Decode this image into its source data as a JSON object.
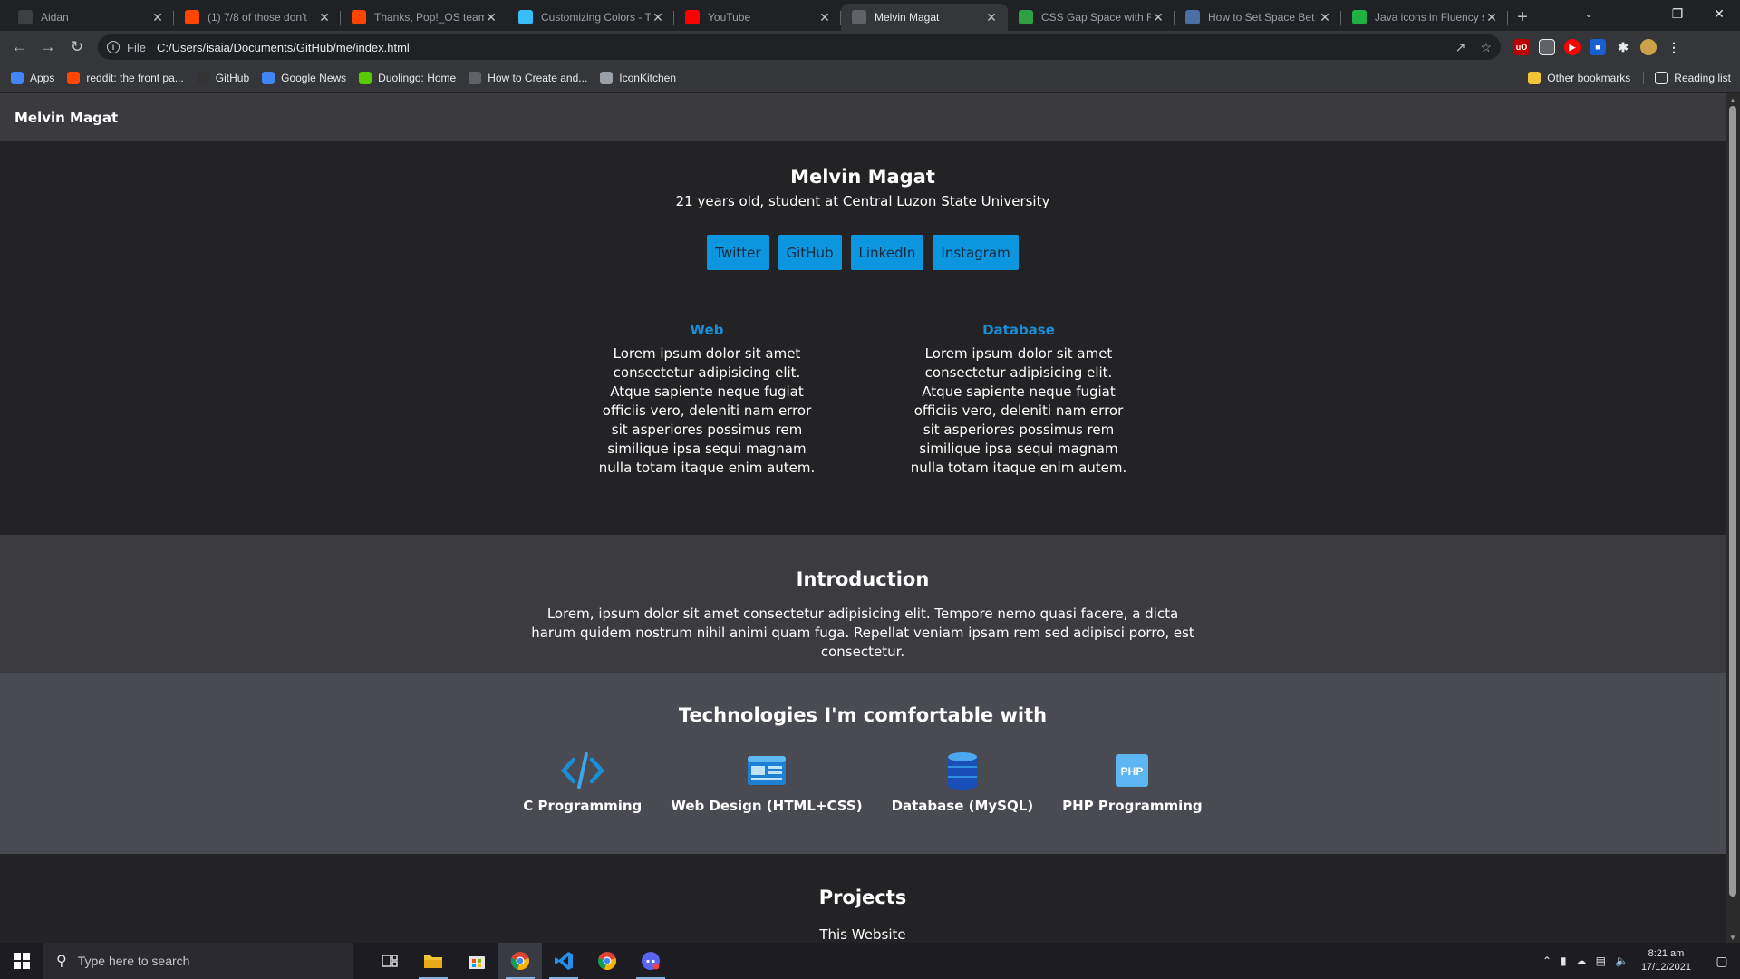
{
  "browser": {
    "tabs": [
      {
        "title": "Aidan",
        "icon": "aidan-favicon",
        "color": "#3c4043"
      },
      {
        "title": "(1) 7/8 of those don't",
        "icon": "reddit-favicon",
        "color": "#ff4500"
      },
      {
        "title": "Thanks, Pop!_OS team",
        "icon": "reddit-favicon",
        "color": "#ff4500"
      },
      {
        "title": "Customizing Colors - T",
        "icon": "tailwind-favicon",
        "color": "#38bdf8"
      },
      {
        "title": "YouTube",
        "icon": "youtube-favicon",
        "color": "#ff0000"
      },
      {
        "title": "Melvin Magat",
        "icon": "globe-favicon",
        "color": "#5f6368",
        "active": true
      },
      {
        "title": "CSS Gap Space with F",
        "icon": "css-favicon",
        "color": "#2ea043"
      },
      {
        "title": "How to Set Space Bet",
        "icon": "page-favicon",
        "color": "#4a6fa5"
      },
      {
        "title": "Java icons in Fluency s",
        "icon": "icons8-favicon",
        "color": "#1fb141"
      }
    ],
    "address": {
      "scheme": "File",
      "url": "C:/Users/isaia/Documents/GitHub/me/index.html"
    },
    "bookmarks": [
      {
        "label": "Apps",
        "icon": "apps-grid-icon",
        "color": "#4285f4"
      },
      {
        "label": "reddit: the front pa...",
        "icon": "reddit-icon",
        "color": "#ff4500"
      },
      {
        "label": "GitHub",
        "icon": "github-icon",
        "color": "#333333"
      },
      {
        "label": "Google News",
        "icon": "google-news-icon",
        "color": "#4285f4"
      },
      {
        "label": "Duolingo: Home",
        "icon": "duolingo-icon",
        "color": "#58cc02"
      },
      {
        "label": "How to Create and...",
        "icon": "page-icon",
        "color": "#5f6368"
      },
      {
        "label": "IconKitchen",
        "icon": "iconkitchen-icon",
        "color": "#9aa0a6"
      }
    ],
    "bookmarks_right": {
      "other": "Other bookmarks",
      "reading": "Reading list"
    }
  },
  "site": {
    "nav_title": "Melvin Magat",
    "hero": {
      "name": "Melvin Magat",
      "subtitle": "21 years old, student at Central Luzon State University",
      "socials": [
        "Twitter",
        "GitHub",
        "LinkedIn",
        "Instagram"
      ],
      "columns": [
        {
          "title": "Web",
          "text": "Lorem ipsum dolor sit amet consectetur adipisicing elit. Atque sapiente neque fugiat officiis vero, deleniti nam error sit asperiores possimus rem similique ipsa sequi magnam nulla totam itaque enim autem."
        },
        {
          "title": "Database",
          "text": "Lorem ipsum dolor sit amet consectetur adipisicing elit. Atque sapiente neque fugiat officiis vero, deleniti nam error sit asperiores possimus rem similique ipsa sequi magnam nulla totam itaque enim autem."
        }
      ]
    },
    "intro": {
      "title": "Introduction",
      "text": "Lorem, ipsum dolor sit amet consectetur adipisicing elit. Tempore nemo quasi facere, a dicta harum quidem nostrum nihil animi quam fuga. Repellat veniam ipsam rem sed adipisci porro, est consectetur."
    },
    "tech": {
      "title": "Technologies I'm comfortable with",
      "items": [
        {
          "label": "C Programming",
          "icon": "code-icon"
        },
        {
          "label": "Web Design (HTML+CSS)",
          "icon": "web-design-icon"
        },
        {
          "label": "Database (MySQL)",
          "icon": "database-icon"
        },
        {
          "label": "PHP Programming",
          "icon": "php-icon"
        }
      ]
    },
    "projects": {
      "title": "Projects",
      "first": "This Website"
    },
    "colors": {
      "accent": "#0d96e0",
      "heading_link": "#1a8fd8"
    }
  },
  "taskbar": {
    "search_placeholder": "Type here to search",
    "time": "8:21 am",
    "date": "17/12/2021"
  }
}
